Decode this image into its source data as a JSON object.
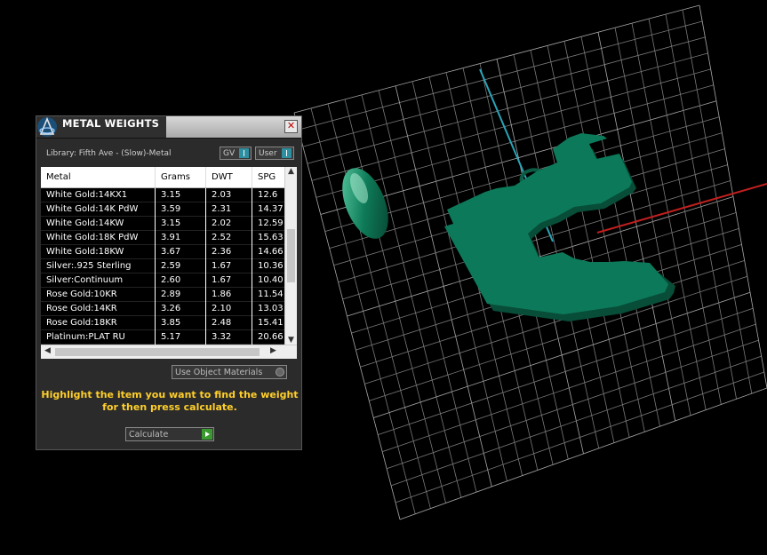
{
  "panel": {
    "title": "METAL WEIGHTS",
    "close_symbol": "✕",
    "library_label": "Library: Fifth Ave - (Slow)-Metal",
    "toggle_gv": "GV",
    "toggle_user": "User",
    "use_object_materials": "Use Object Materials",
    "instructions": "Highlight the item you want to find the weight for then press calculate.",
    "calculate_label": "Calculate"
  },
  "table": {
    "headers": [
      "Metal",
      "Grams",
      "DWT",
      "SPG"
    ],
    "rows": [
      [
        "White Gold:14KX1",
        "3.15",
        "2.03",
        "12.6"
      ],
      [
        "White Gold:14K PdW",
        "3.59",
        "2.31",
        "14.37"
      ],
      [
        "White Gold:14KW",
        "3.15",
        "2.02",
        "12.59"
      ],
      [
        "White Gold:18K PdW",
        "3.91",
        "2.52",
        "15.63"
      ],
      [
        "White Gold:18KW",
        "3.67",
        "2.36",
        "14.66"
      ],
      [
        "Silver:.925 Sterling",
        "2.59",
        "1.67",
        "10.36"
      ],
      [
        "Silver:Continuum",
        "2.60",
        "1.67",
        "10.40"
      ],
      [
        "Rose Gold:10KR",
        "2.89",
        "1.86",
        "11.54"
      ],
      [
        "Rose Gold:14KR",
        "3.26",
        "2.10",
        "13.03"
      ],
      [
        "Rose Gold:18KR",
        "3.85",
        "2.48",
        "15.41"
      ],
      [
        "Platinum:PLAT RU",
        "5.17",
        "3.32",
        "20.66"
      ]
    ]
  },
  "colors": {
    "accent_teal": "#2e8fa0",
    "instruction_yellow": "#ffcf2a",
    "model_green": "#0c7a5a"
  }
}
